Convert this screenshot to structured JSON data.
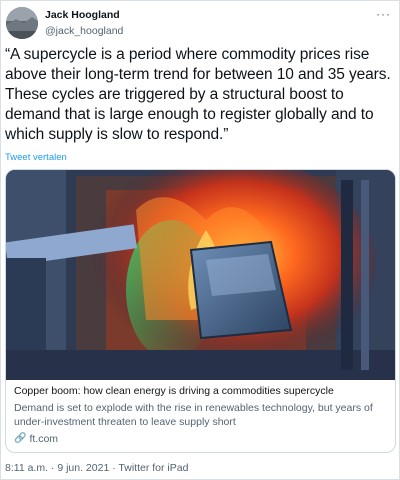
{
  "author": {
    "name": "Jack Hoogland",
    "handle": "@jack_hoogland"
  },
  "tweet": {
    "text": "“A supercycle is a period where commodity prices rise above their long-term trend for between 10 and 35 years. These cycles are triggered by a structural boost to demand that is large enough to register globally and to which supply is slow to respond.”",
    "translate_label": "Tweet vertalen",
    "more_icon": "···"
  },
  "card": {
    "title": "Copper boom: how clean energy is driving a commodities supercycle",
    "description": "Demand is set to explode with the rise in renewables technology, but years of under-investment threaten to leave supply short",
    "domain": "ft.com",
    "link_icon": "link-icon"
  },
  "meta": {
    "text": "8:11 a.m. · 9 jun. 2021 · Twitter for iPad"
  }
}
